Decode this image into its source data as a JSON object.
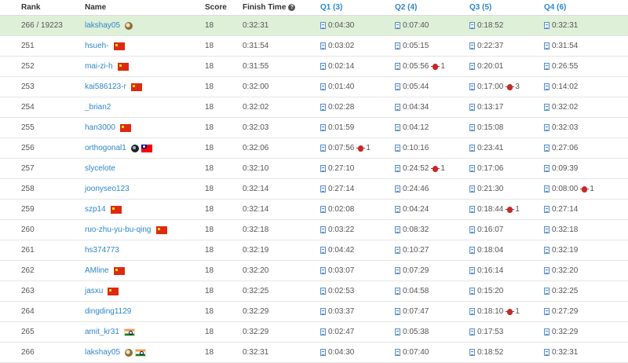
{
  "header": {
    "rank": "Rank",
    "name": "Name",
    "score": "Score",
    "finish_time": "Finish Time",
    "help_icon": "?",
    "q1": "Q1 (3)",
    "q2": "Q2 (4)",
    "q3": "Q3 (5)",
    "q4": "Q4 (6)"
  },
  "rows": [
    {
      "rank": "266 / 19223",
      "name": "lakshay05",
      "icons": [
        "badge"
      ],
      "score": "18",
      "finish": "0:32:31",
      "q": [
        {
          "t": "0:04:30"
        },
        {
          "t": "0:07:40"
        },
        {
          "t": "0:18:52"
        },
        {
          "t": "0:32:31"
        }
      ],
      "me": true
    },
    {
      "rank": "251",
      "name": "hsueh-",
      "icons": [
        "cn"
      ],
      "score": "18",
      "finish": "0:31:54",
      "q": [
        {
          "t": "0:03:02"
        },
        {
          "t": "0:05:15"
        },
        {
          "t": "0:22:37"
        },
        {
          "t": "0:31:54"
        }
      ]
    },
    {
      "rank": "252",
      "name": "mai-zi-h",
      "icons": [
        "cn"
      ],
      "score": "18",
      "finish": "0:31:55",
      "q": [
        {
          "t": "0:02:14"
        },
        {
          "t": "0:05:56",
          "bugs": "1"
        },
        {
          "t": "0:20:01"
        },
        {
          "t": "0:26:55"
        }
      ]
    },
    {
      "rank": "253",
      "name": "kai586123-r",
      "icons": [
        "cn"
      ],
      "score": "18",
      "finish": "0:32:00",
      "q": [
        {
          "t": "0:01:40"
        },
        {
          "t": "0:05:44"
        },
        {
          "t": "0:17:00",
          "bugs": "3"
        },
        {
          "t": "0:14:02"
        }
      ]
    },
    {
      "rank": "254",
      "name": "_brian2",
      "icons": [],
      "score": "18",
      "finish": "0:32:02",
      "q": [
        {
          "t": "0:02:28"
        },
        {
          "t": "0:04:34"
        },
        {
          "t": "0:13:17"
        },
        {
          "t": "0:32:02"
        }
      ]
    },
    {
      "rank": "255",
      "name": "han3000",
      "icons": [
        "cn"
      ],
      "score": "18",
      "finish": "0:32:03",
      "q": [
        {
          "t": "0:01:59"
        },
        {
          "t": "0:04:12"
        },
        {
          "t": "0:15:08"
        },
        {
          "t": "0:32:03"
        }
      ]
    },
    {
      "rank": "256",
      "name": "orthogonal1",
      "icons": [
        "badge-dark",
        "tw"
      ],
      "score": "18",
      "finish": "0:32:06",
      "q": [
        {
          "t": "0:07:56",
          "bugs": "1"
        },
        {
          "t": "0:10:16"
        },
        {
          "t": "0:23:41"
        },
        {
          "t": "0:27:06"
        }
      ]
    },
    {
      "rank": "257",
      "name": "slycelote",
      "icons": [],
      "score": "18",
      "finish": "0:32:10",
      "q": [
        {
          "t": "0:27:10"
        },
        {
          "t": "0:24:52",
          "bugs": "1"
        },
        {
          "t": "0:17:06"
        },
        {
          "t": "0:09:39"
        }
      ]
    },
    {
      "rank": "258",
      "name": "joonyseo123",
      "icons": [],
      "score": "18",
      "finish": "0:32:14",
      "q": [
        {
          "t": "0:27:14"
        },
        {
          "t": "0:24:46"
        },
        {
          "t": "0:21:30"
        },
        {
          "t": "0:08:00",
          "bugs": "1"
        }
      ]
    },
    {
      "rank": "259",
      "name": "szp14",
      "icons": [
        "cn"
      ],
      "score": "18",
      "finish": "0:32:14",
      "q": [
        {
          "t": "0:02:08"
        },
        {
          "t": "0:04:24"
        },
        {
          "t": "0:18:44",
          "bugs": "1"
        },
        {
          "t": "0:27:14"
        }
      ]
    },
    {
      "rank": "260",
      "name": "ruo-zhu-yu-bu-qing",
      "icons": [
        "cn"
      ],
      "score": "18",
      "finish": "0:32:18",
      "q": [
        {
          "t": "0:03:22"
        },
        {
          "t": "0:08:32"
        },
        {
          "t": "0:16:07"
        },
        {
          "t": "0:32:18"
        }
      ]
    },
    {
      "rank": "261",
      "name": "hs374773",
      "icons": [],
      "score": "18",
      "finish": "0:32:19",
      "q": [
        {
          "t": "0:04:42"
        },
        {
          "t": "0:10:27"
        },
        {
          "t": "0:18:04"
        },
        {
          "t": "0:32:19"
        }
      ]
    },
    {
      "rank": "262",
      "name": "AMline",
      "icons": [
        "cn"
      ],
      "score": "18",
      "finish": "0:32:20",
      "q": [
        {
          "t": "0:03:07"
        },
        {
          "t": "0:07:29"
        },
        {
          "t": "0:16:14"
        },
        {
          "t": "0:32:20"
        }
      ]
    },
    {
      "rank": "263",
      "name": "jasxu",
      "icons": [
        "cn"
      ],
      "score": "18",
      "finish": "0:32:25",
      "q": [
        {
          "t": "0:02:53"
        },
        {
          "t": "0:04:58"
        },
        {
          "t": "0:15:20"
        },
        {
          "t": "0:32:25"
        }
      ]
    },
    {
      "rank": "264",
      "name": "dingding1129",
      "icons": [],
      "score": "18",
      "finish": "0:32:29",
      "q": [
        {
          "t": "0:03:37"
        },
        {
          "t": "0:07:47"
        },
        {
          "t": "0:18:10",
          "bugs": "1"
        },
        {
          "t": "0:27:29"
        }
      ]
    },
    {
      "rank": "265",
      "name": "amit_kr31",
      "icons": [
        "in"
      ],
      "score": "18",
      "finish": "0:32:29",
      "q": [
        {
          "t": "0:02:47"
        },
        {
          "t": "0:05:38"
        },
        {
          "t": "0:17:53"
        },
        {
          "t": "0:32:29"
        }
      ]
    },
    {
      "rank": "266",
      "name": "lakshay05",
      "icons": [
        "badge",
        "in"
      ],
      "score": "18",
      "finish": "0:32:31",
      "q": [
        {
          "t": "0:04:30"
        },
        {
          "t": "0:07:40"
        },
        {
          "t": "0:18:52"
        },
        {
          "t": "0:32:31"
        }
      ]
    }
  ],
  "colors": {
    "link": "#2e87c8",
    "highlight_row": "#dff0d8",
    "bug": "#c62828"
  }
}
